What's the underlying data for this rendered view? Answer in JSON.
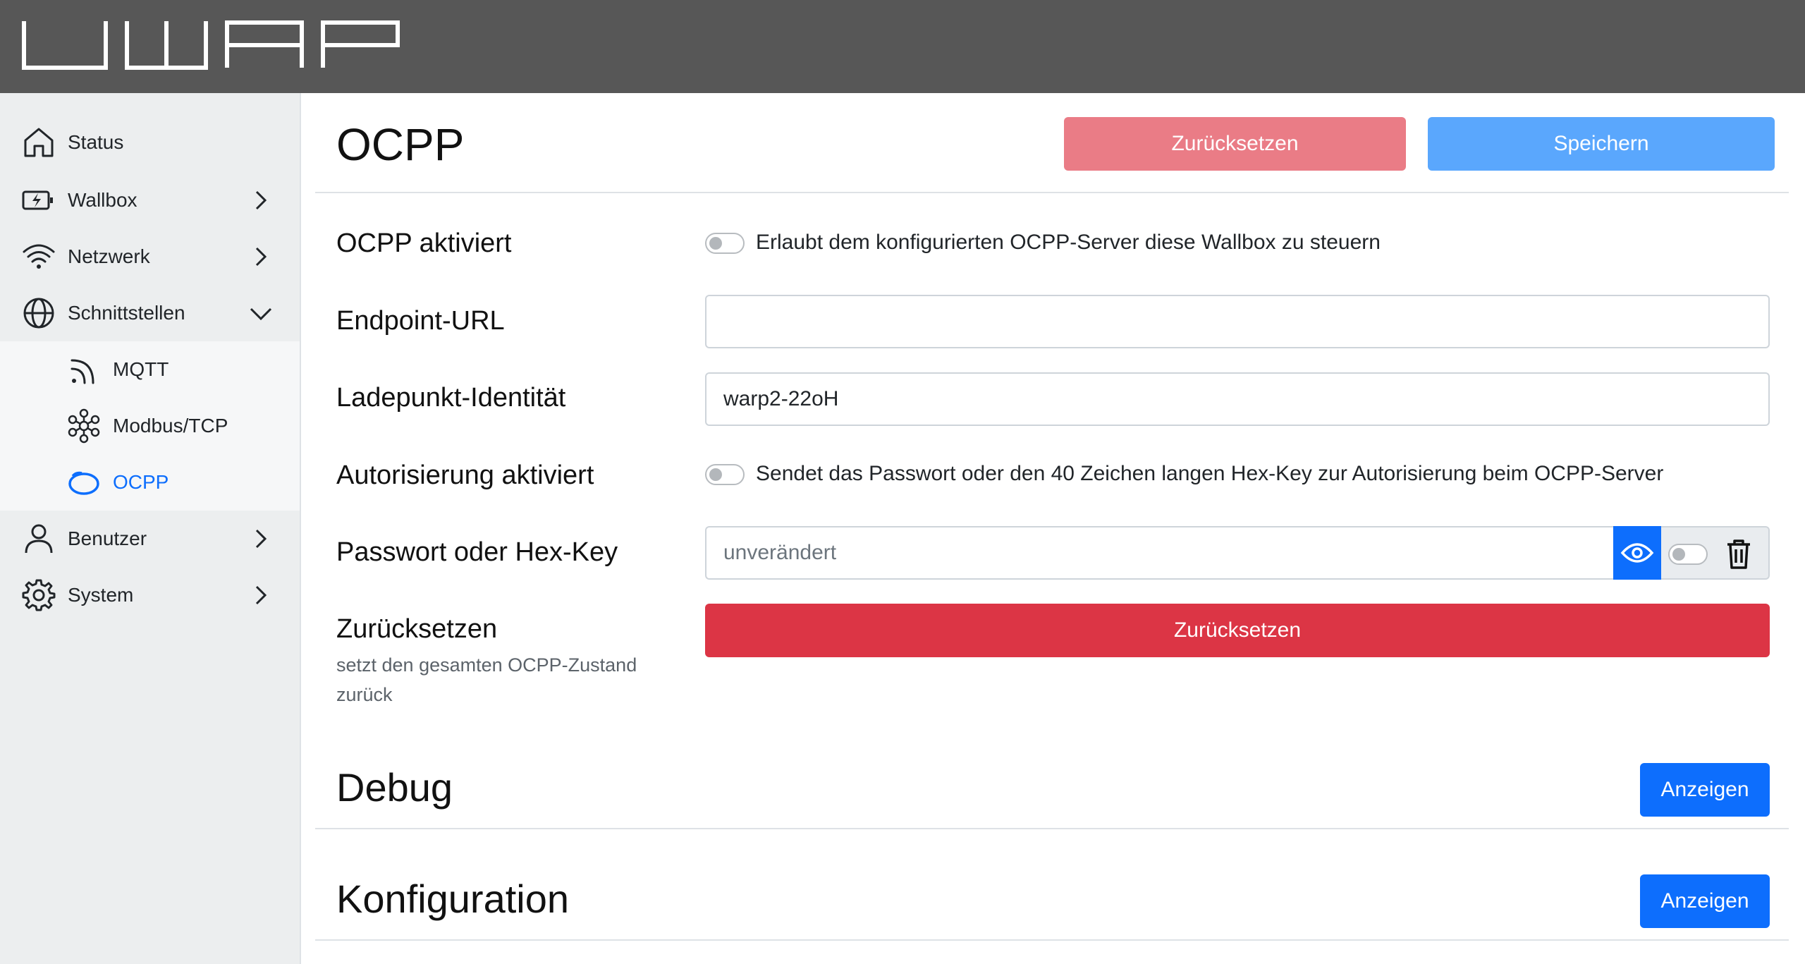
{
  "header": {
    "logo_text": "WARP"
  },
  "sidebar": {
    "items": [
      {
        "label": "Status",
        "icon": "home-icon"
      },
      {
        "label": "Wallbox",
        "icon": "charger-icon"
      },
      {
        "label": "Netzwerk",
        "icon": "wifi-icon"
      },
      {
        "label": "Schnittstellen",
        "icon": "globe-icon"
      },
      {
        "label": "Benutzer",
        "icon": "user-icon"
      },
      {
        "label": "System",
        "icon": "gear-icon"
      }
    ],
    "sub_items": [
      {
        "label": "MQTT",
        "icon": "rss-icon"
      },
      {
        "label": "Modbus/TCP",
        "icon": "network-icon"
      },
      {
        "label": "OCPP",
        "icon": "ocpp-icon",
        "active": true
      }
    ]
  },
  "main": {
    "title": "OCPP",
    "reset_label": "Zurücksetzen",
    "save_label": "Speichern",
    "ocpp_enabled": {
      "label": "OCPP aktiviert",
      "text": "Erlaubt dem konfigurierten OCPP-Server diese Wallbox zu steuern"
    },
    "endpoint_url": {
      "label": "Endpoint-URL",
      "value": ""
    },
    "charge_point_id": {
      "label": "Ladepunkt-Identität",
      "value": "warp2-22oH"
    },
    "auth_enabled": {
      "label": "Autorisierung aktiviert",
      "text": "Sendet das Passwort oder den 40 Zeichen langen Hex-Key zur Autorisierung beim OCPP-Server"
    },
    "password": {
      "label": "Passwort oder Hex-Key",
      "placeholder": "unverändert"
    },
    "reset_ocpp": {
      "label": "Zurücksetzen",
      "sub": "setzt den gesamten OCPP-Zustand zurück",
      "button": "Zurücksetzen"
    },
    "debug": {
      "title": "Debug",
      "button": "Anzeigen"
    },
    "config": {
      "title": "Konfiguration",
      "button": "Anzeigen"
    }
  },
  "colors": {
    "accent": "#0d6efd",
    "danger": "#dc3545",
    "header": "#575757"
  }
}
